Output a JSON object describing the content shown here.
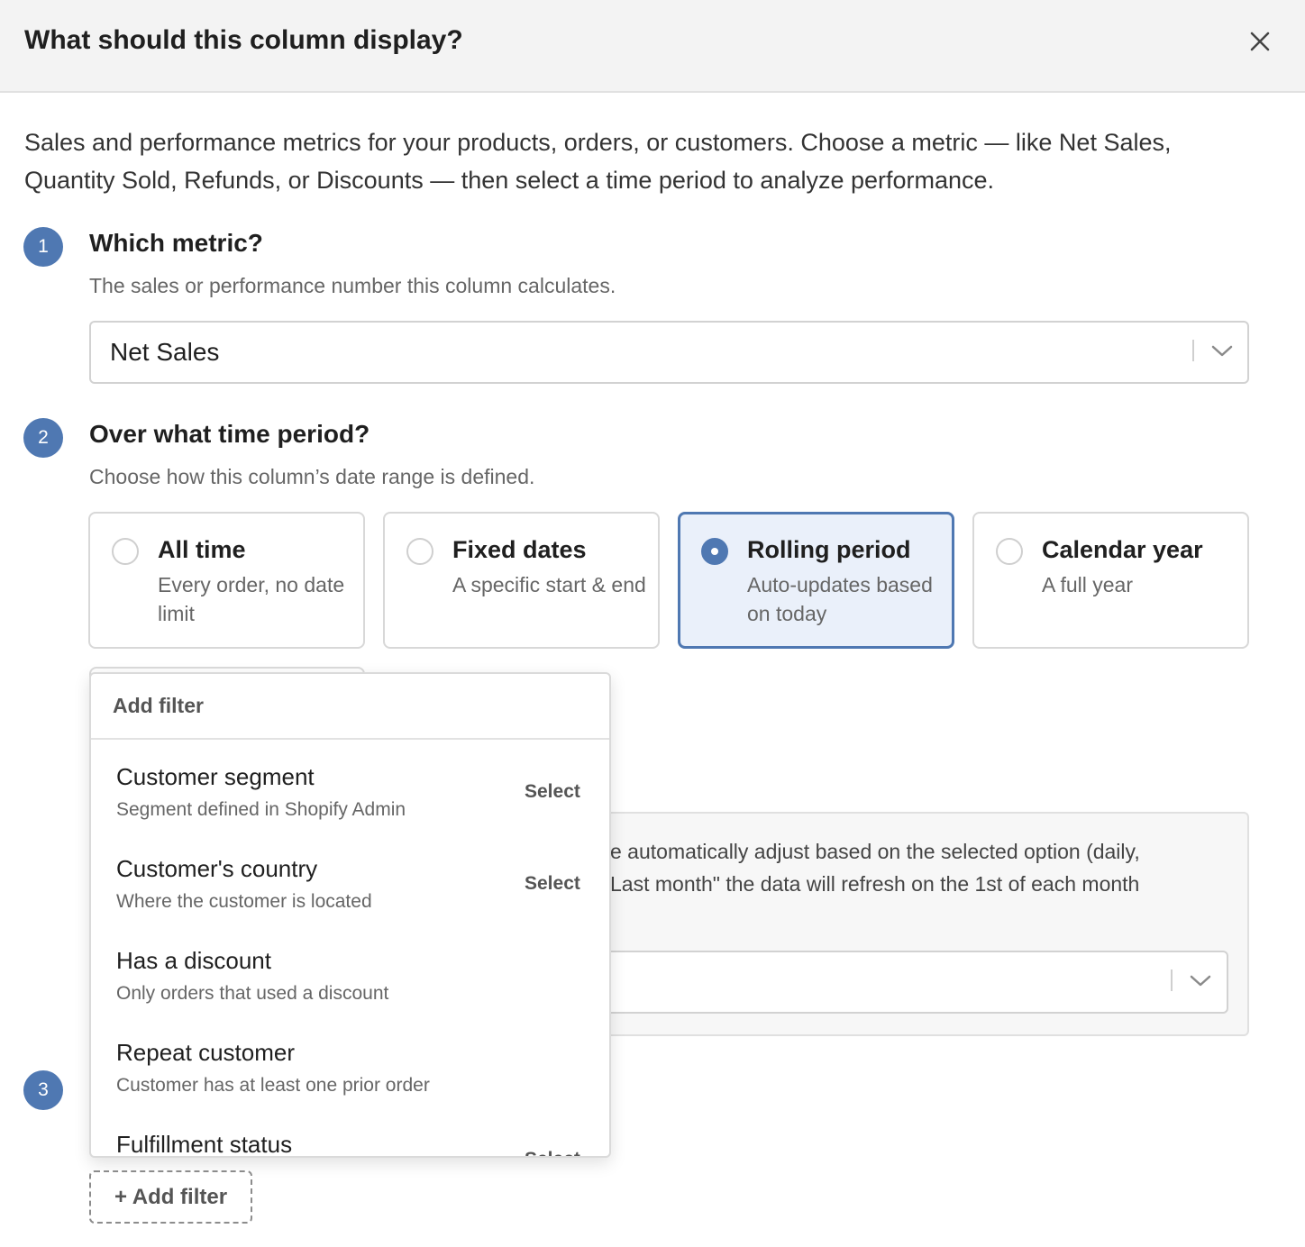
{
  "modal": {
    "title": "What should this column display?",
    "intro": "Sales and performance metrics for your products, orders, or customers. Choose a metric — like Net Sales, Quantity Sold, Refunds, or Discounts — then select a time period to analyze performance."
  },
  "steps": [
    {
      "number": "1",
      "title": "Which metric?",
      "description": "The sales or performance number this column calculates."
    },
    {
      "number": "2",
      "title": "Over what time period?",
      "description": "Choose how this column’s date range is defined."
    },
    {
      "number": "3"
    }
  ],
  "metric_select": {
    "value": "Net Sales",
    "icon": "chevron-down-icon"
  },
  "period_options": [
    {
      "title": "All time",
      "description": "Every order, no date limit",
      "selected": false
    },
    {
      "title": "Fixed dates",
      "description": "A specific start & end",
      "selected": false
    },
    {
      "title": "Rolling period",
      "description": "Auto-updates based on today",
      "selected": true
    },
    {
      "title": "Calendar year",
      "description": "A full year",
      "selected": false
    }
  ],
  "info": {
    "line1": "e automatically adjust based on the selected option (daily,",
    "line2": " Last month\" the data will refresh on the 1st of each month"
  },
  "filter_dropdown": {
    "title": "Add filter",
    "options": [
      {
        "name": "Customer segment",
        "description": "Segment defined in Shopify Admin",
        "action": "Select"
      },
      {
        "name": "Customer's country",
        "description": "Where the customer is located",
        "action": "Select"
      },
      {
        "name": "Has a discount",
        "description": "Only orders that used a discount",
        "action": ""
      },
      {
        "name": "Repeat customer",
        "description": "Customer has at least one prior order",
        "action": ""
      },
      {
        "name": "Fulfillment status",
        "description": "",
        "action": "Select"
      }
    ]
  },
  "add_filter_button": "+ Add filter",
  "colors": {
    "accent": "#4f78b2",
    "selected_bg": "#eaf0fa",
    "header_bg": "#f3f3f3"
  }
}
